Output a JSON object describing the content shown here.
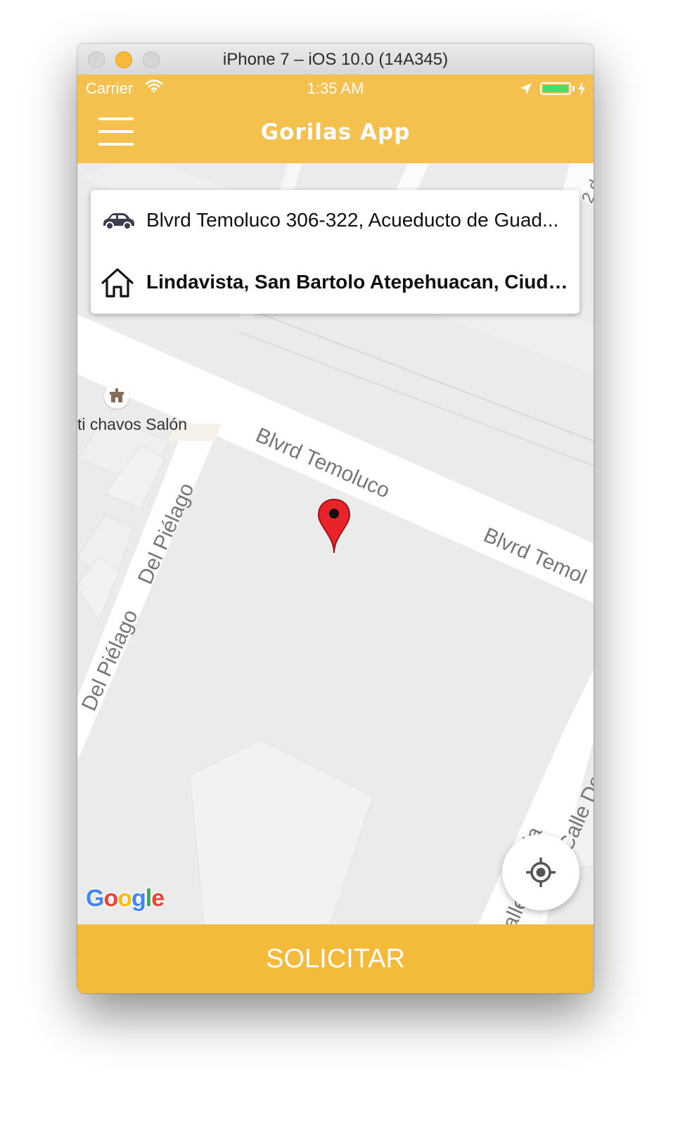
{
  "window": {
    "title": "iPhone 7 – iOS 10.0 (14A345)"
  },
  "status_bar": {
    "carrier": "Carrier",
    "time": "1:35 AM",
    "battery_color": "#4cd964"
  },
  "nav": {
    "title": "Gorilas App",
    "menu_icon": "hamburger-menu-icon",
    "bar_color": "#f4c04e"
  },
  "route": {
    "origin": {
      "icon": "car-icon",
      "address": "Blvrd Temoluco 306-322, Acueducto de Guad..."
    },
    "destination": {
      "icon": "house-icon",
      "address": "Lindavista, San Bartolo Atepehuacan, Ciudad..."
    }
  },
  "map": {
    "labels": {
      "boulevard_main": "Blvrd Temoluco",
      "boulevard_right": "Blvrd Temol",
      "street_left_1": "Del Piélago",
      "street_left_2": "Del Piélago",
      "street_right": "Calle De L",
      "street_right_partial": "la",
      "street_bottom_partial": "alle",
      "street_top_partial": "2 d",
      "poi": "ti chavos Salón"
    },
    "attribution": "Google",
    "pin_color": "#e8232a",
    "locate_icon": "gps-crosshair-icon"
  },
  "request_button": {
    "label": "SOLICITAR",
    "color": "#f4bb3a"
  }
}
